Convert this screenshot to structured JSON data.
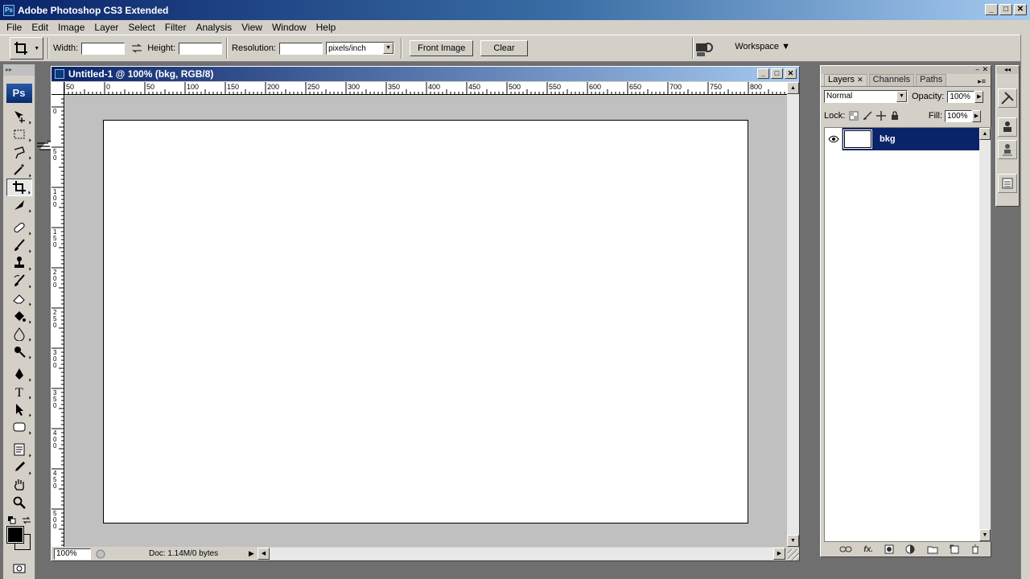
{
  "app": {
    "title": "Adobe Photoshop CS3 Extended",
    "icon": "Ps",
    "window_buttons": [
      "_",
      "□",
      "✕"
    ]
  },
  "menu": [
    "File",
    "Edit",
    "Image",
    "Layer",
    "Select",
    "Filter",
    "Analysis",
    "View",
    "Window",
    "Help"
  ],
  "options": {
    "width_label": "Width:",
    "width_value": "",
    "swap_icon": "swap-arrows-icon",
    "height_label": "Height:",
    "height_value": "",
    "resolution_label": "Resolution:",
    "resolution_value": "",
    "resolution_unit": "pixels/inch",
    "front_image_label": "Front Image",
    "clear_label": "Clear",
    "workspace_label": "Workspace ▼"
  },
  "toolbox": {
    "logo": "Ps",
    "tools": [
      "move",
      "marquee",
      "lasso",
      "magic-wand",
      "crop",
      "slice",
      "healing-brush",
      "brush",
      "clone-stamp",
      "history-brush",
      "eraser",
      "paint-bucket",
      "blur",
      "dodge",
      "pen",
      "type",
      "path-selection",
      "rectangle",
      "notes",
      "eyedropper",
      "hand",
      "zoom"
    ],
    "selected_tool": "crop",
    "foreground_color": "#000000",
    "background_color": "#ffffff"
  },
  "document": {
    "title": "Untitled-1 @ 100% (bkg, RGB/8)",
    "zoom": "100%",
    "doc_info": "Doc: 1.14M/0 bytes",
    "h_ruler_labels": [
      "50",
      "0",
      "50",
      "100",
      "150",
      "200",
      "250",
      "300",
      "350",
      "400",
      "450",
      "500",
      "550",
      "600",
      "650",
      "700",
      "750",
      "800"
    ],
    "v_ruler_labels": [
      "0",
      "50",
      "100",
      "150",
      "200",
      "250",
      "300",
      "350",
      "400",
      "450",
      "500"
    ]
  },
  "layers_panel": {
    "tabs": [
      "Layers",
      "Channels",
      "Paths"
    ],
    "active_tab": "Layers",
    "blend_mode": "Normal",
    "opacity_label": "Opacity:",
    "opacity_value": "100%",
    "lock_label": "Lock:",
    "fill_label": "Fill:",
    "fill_value": "100%",
    "layers": [
      {
        "name": "bkg",
        "visible": true,
        "selected": true
      }
    ]
  },
  "colors": {
    "titlebar_start": "#0a246a",
    "titlebar_end": "#a6caf0",
    "chrome": "#d4d0c8",
    "selection": "#0a246a"
  }
}
